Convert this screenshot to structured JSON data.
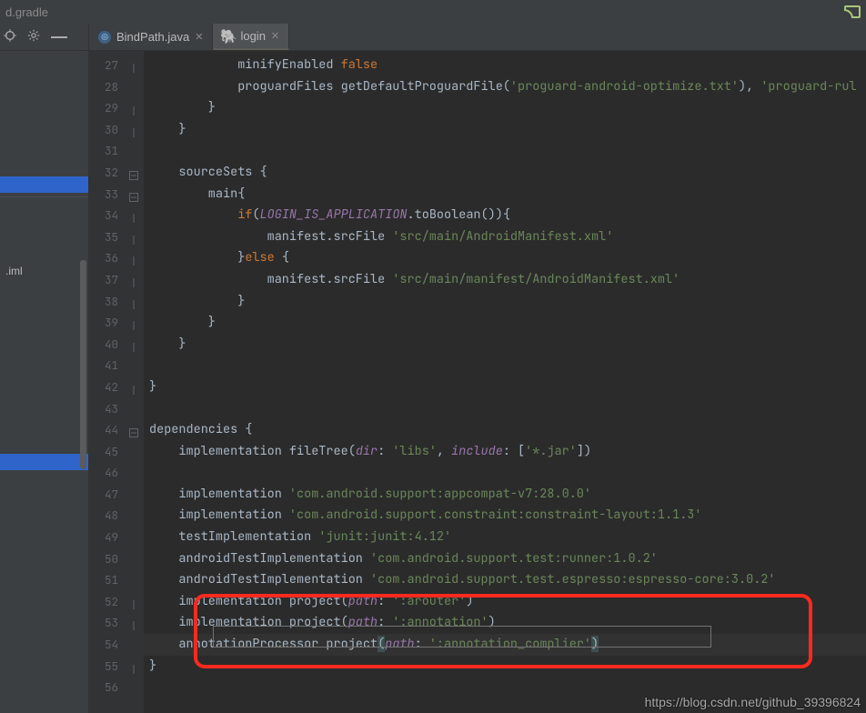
{
  "topbar": {
    "filename": "d.gradle"
  },
  "tabs": [
    {
      "label": "BindPath.java",
      "type": "java",
      "active": false
    },
    {
      "label": "login",
      "type": "gradle",
      "active": true
    }
  ],
  "sidebar": {
    "items": [
      {
        "label": "",
        "selected": false
      },
      {
        "label": "",
        "selected": false
      },
      {
        "label": ".iml",
        "selected": false
      }
    ]
  },
  "gutter": {
    "start": 27,
    "end": 56
  },
  "code": {
    "lines": [
      {
        "n": 27,
        "t": "            minifyEnabled ",
        "k": "",
        "s": "",
        "b": "false",
        "tail": ""
      },
      {
        "n": 28,
        "t": "            proguardFiles getDefaultProguardFile(",
        "s": "'proguard-android-optimize.txt'",
        "mid": "), ",
        "s2": "'proguard-rul"
      },
      {
        "n": 29,
        "t": "        }"
      },
      {
        "n": 30,
        "t": "    }"
      },
      {
        "n": 31,
        "t": ""
      },
      {
        "n": 32,
        "t": "    sourceSets {"
      },
      {
        "n": 33,
        "t": "        main{"
      },
      {
        "n": 34,
        "pre": "            ",
        "kw": "if",
        "mid": "(",
        "cst": "LOGIN_IS_APPLICATION",
        "post": ".toBoolean()){"
      },
      {
        "n": 35,
        "pre": "                manifest.srcFile ",
        "s": "'src/main/AndroidManifest.xml'"
      },
      {
        "n": 36,
        "pre": "            }",
        "kw": "else",
        "post": " {"
      },
      {
        "n": 37,
        "pre": "                manifest.srcFile ",
        "s": "'src/main/manifest/AndroidManifest.xml'"
      },
      {
        "n": 38,
        "t": "            }"
      },
      {
        "n": 39,
        "t": "        }"
      },
      {
        "n": 40,
        "t": "    }"
      },
      {
        "n": 41,
        "t": ""
      },
      {
        "n": 42,
        "t": "}"
      },
      {
        "n": 43,
        "t": ""
      },
      {
        "n": 44,
        "t": "dependencies {"
      },
      {
        "n": 45,
        "pre": "    implementation fileTree(",
        "pn": "dir",
        "mid": ": ",
        "s": "'libs'",
        "mid2": ", ",
        "pn2": "include",
        "mid3": ": [",
        "s2": "'*.jar'",
        "post": "])"
      },
      {
        "n": 46,
        "t": ""
      },
      {
        "n": 47,
        "pre": "    implementation ",
        "s": "'com.android.support:appcompat-v7:28.0.0'"
      },
      {
        "n": 48,
        "pre": "    implementation ",
        "s": "'com.android.support.constraint:constraint-layout:1.1.3'"
      },
      {
        "n": 49,
        "pre": "    testImplementation ",
        "s": "'junit:junit:4.12'"
      },
      {
        "n": 50,
        "pre": "    androidTestImplementation ",
        "s": "'com.android.support.test:runner:1.0.2'"
      },
      {
        "n": 51,
        "pre": "    androidTestImplementation ",
        "s": "'com.android.support.test.espresso:espresso-core:3.0.2'"
      },
      {
        "n": 52,
        "pre": "    implementation project(",
        "pn": "path",
        "mid": ": ",
        "s": "':arouter'",
        "post": ")"
      },
      {
        "n": 53,
        "pre": "    implementation project(",
        "pn": "path",
        "mid": ": ",
        "s": "':annotation'",
        "post": ")"
      },
      {
        "n": 54,
        "pre": "    annotationProcessor project",
        "paren": "(",
        "pn": "path",
        "mid": ": ",
        "s": "':annotation_complier'",
        "paren2": ")"
      },
      {
        "n": 55,
        "t": "}"
      },
      {
        "n": 56,
        "t": ""
      }
    ]
  },
  "watermark": "https://blog.csdn.net/github_39396824"
}
